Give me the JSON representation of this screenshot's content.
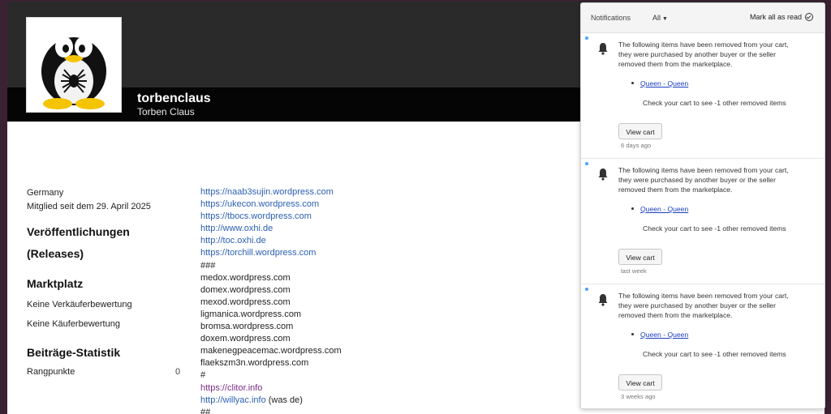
{
  "profile": {
    "username": "torbenclaus",
    "real_name": "Torben Claus",
    "avatar_alt": "penguin-spider-avatar"
  },
  "sidebar": {
    "country": "Germany",
    "member_since": "Mitglied seit dem 29. April 2025",
    "releases_heading_1": "Veröffentlichungen",
    "releases_heading_2": "(Releases)",
    "market_heading": "Marktplatz",
    "seller_rating": "Keine Verkäuferbewertung",
    "buyer_rating": "Keine Käuferbewertung",
    "stats_heading": "Beiträge-Statistik",
    "rank_label": "Rangpunkte",
    "rank_value": "0"
  },
  "about_lines": [
    {
      "text": "https://naab3sujin.wordpress.com",
      "kind": "link",
      "suffix": ""
    },
    {
      "text": "https://ukecon.wordpress.com",
      "kind": "link",
      "suffix": ""
    },
    {
      "text": "https://tbocs.wordpress.com",
      "kind": "link",
      "suffix": ""
    },
    {
      "text": "http://www.oxhi.de",
      "kind": "link",
      "suffix": ""
    },
    {
      "text": "http://toc.oxhi.de",
      "kind": "link",
      "suffix": ""
    },
    {
      "text": "https://torchill.wordpress.com",
      "kind": "link",
      "suffix": ""
    },
    {
      "text": "###",
      "kind": "text",
      "suffix": ""
    },
    {
      "text": "medox.wordpress.com",
      "kind": "text",
      "suffix": ""
    },
    {
      "text": "domex.wordpress.com",
      "kind": "text",
      "suffix": ""
    },
    {
      "text": "mexod.wordpress.com",
      "kind": "text",
      "suffix": ""
    },
    {
      "text": "ligmanica.wordpress.com",
      "kind": "text",
      "suffix": ""
    },
    {
      "text": "bromsa.wordpress.com",
      "kind": "text",
      "suffix": ""
    },
    {
      "text": "doxem.wordpress.com",
      "kind": "text",
      "suffix": ""
    },
    {
      "text": "makenegpeacemac.wordpress.com",
      "kind": "text",
      "suffix": ""
    },
    {
      "text": "flaekszm3n.wordpress.com",
      "kind": "text",
      "suffix": ""
    },
    {
      "text": "#",
      "kind": "text",
      "suffix": ""
    },
    {
      "text": "https://clitor.info",
      "kind": "visited",
      "suffix": ""
    },
    {
      "text": "http://willyac.info",
      "kind": "link",
      "suffix": " (was de)"
    },
    {
      "text": "##",
      "kind": "text",
      "suffix": ""
    }
  ],
  "notifications": {
    "title": "Notifications",
    "filter": "All",
    "mark_all": "Mark all as read",
    "items": [
      {
        "message": "The following items have been removed from your cart, they were purchased by another buyer or the seller removed them from the marketplace.",
        "item_link": "Queen - Queen",
        "check_text": "Check your cart to see -1 other removed items",
        "button": "View cart",
        "time": "6 days ago"
      },
      {
        "message": "The following items have been removed from your cart, they were purchased by another buyer or the seller removed them from the marketplace.",
        "item_link": "Queen - Queen",
        "check_text": "Check your cart to see -1 other removed items",
        "button": "View cart",
        "time": "last week"
      },
      {
        "message": "The following items have been removed from your cart, they were purchased by another buyer or the seller removed them from the marketplace.",
        "item_link": "Queen - Queen",
        "check_text": "Check your cart to see -1 other removed items",
        "button": "View cart",
        "time": "3 weeks ago"
      }
    ]
  },
  "colors": {
    "header_dark": "#2a2a2a",
    "header_black": "#050505",
    "link": "#2b5fb4",
    "visited_link": "#7b2a8a",
    "unread_dot": "#4aa3ff"
  }
}
